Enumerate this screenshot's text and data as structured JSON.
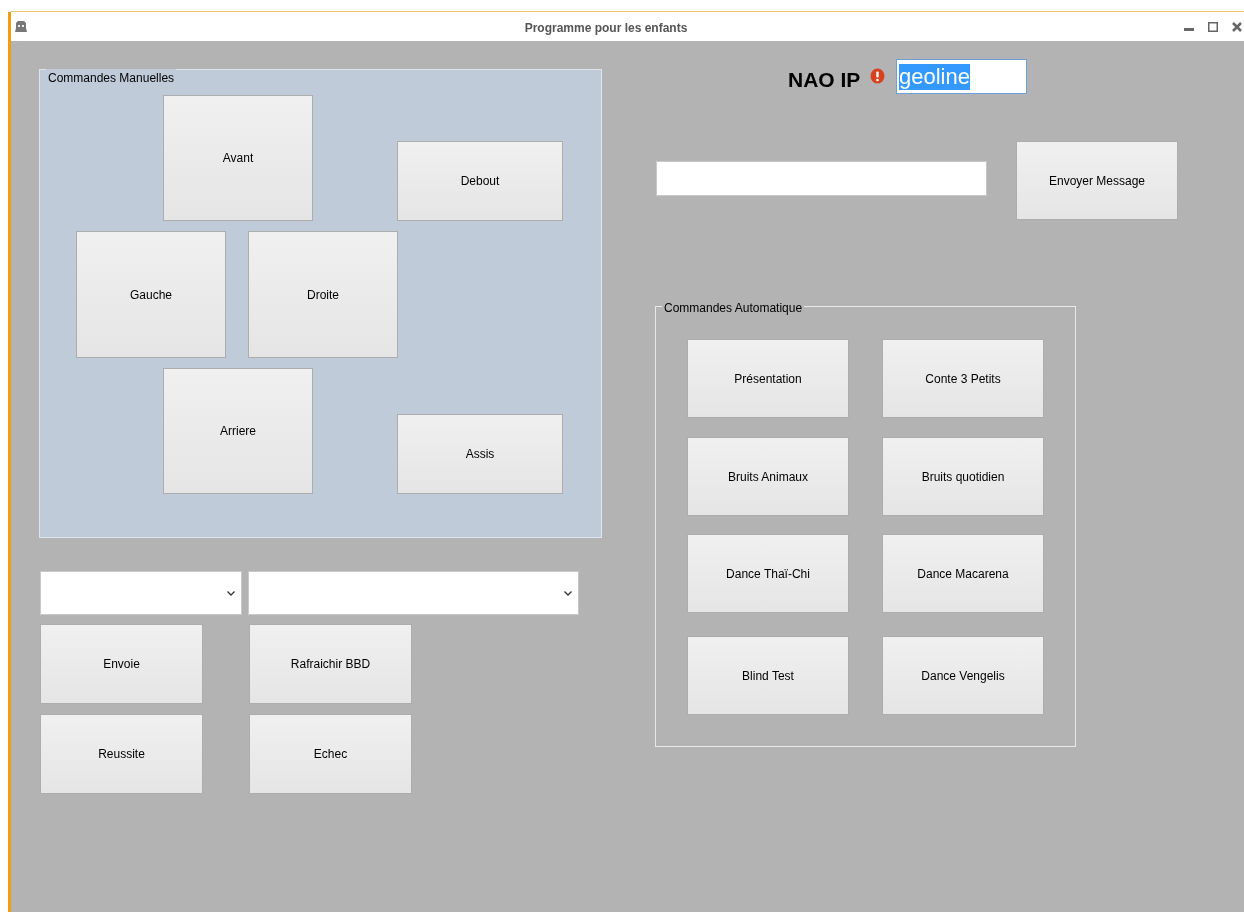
{
  "window": {
    "title": "Programme pour les enfants"
  },
  "manual_commands": {
    "legend": "Commandes Manuelles",
    "buttons": [
      "Avant",
      "Debout",
      "Gauche",
      "Droite",
      "Arriere",
      "Assis"
    ]
  },
  "nao_ip": {
    "label": "NAO IP",
    "value": "geoline",
    "value_selected": true
  },
  "message": {
    "button": "Envoyer Message"
  },
  "auto_commands": {
    "legend": "Commandes Automatique",
    "buttons": [
      "Présentation",
      "Conte 3 Petits",
      "Bruits Animaux",
      "Bruits quotidien",
      "Dance Thaï-Chi",
      "Dance Macarena",
      "Blind Test",
      "Dance Vengelis"
    ]
  },
  "dropdowns": [
    {
      "kind": "combo"
    },
    {
      "kind": "combo"
    }
  ],
  "bottom_buttons": [
    "Envoie",
    "Rafraichir BBD",
    "Reussite",
    "Echec"
  ]
}
